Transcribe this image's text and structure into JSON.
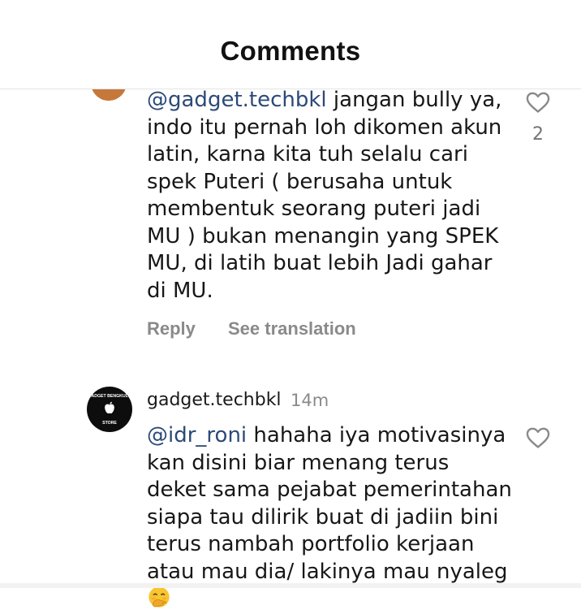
{
  "header": {
    "title": "Comments"
  },
  "comments": [
    {
      "mention": "@gadget.techbkl",
      "text": " jangan bully ya, indo itu pernah loh dikomen akun latin, karna kita tuh selalu cari spek Puteri ( berusaha untuk membentuk seorang puteri jadi MU ) bukan menangin yang SPEK MU, di latih buat lebih Jadi gahar di MU.",
      "like_count": "2",
      "actions": {
        "reply": "Reply",
        "translate": "See translation"
      }
    },
    {
      "username": "gadget.techbkl",
      "time": "14m",
      "avatar_text": {
        "top": "GADGET BENGKULU",
        "bottom": "STORE"
      },
      "mention": "@idr_roni",
      "text": " hahaha iya motivasinya kan disini biar menang terus deket sama pejabat pemerintahan siapa tau dilirik buat di jadiin bini terus nambah portfolio kerjaan atau mau dia/ lakinya mau nyaleg",
      "emoji": "face-with-hand-over-mouth"
    }
  ],
  "icons": {
    "like": "heart-outline-icon",
    "avatar_logo": "apple-logo-icon"
  },
  "colors": {
    "mention": "#2b4a78",
    "text": "#171717",
    "muted": "#8a8a8a"
  }
}
